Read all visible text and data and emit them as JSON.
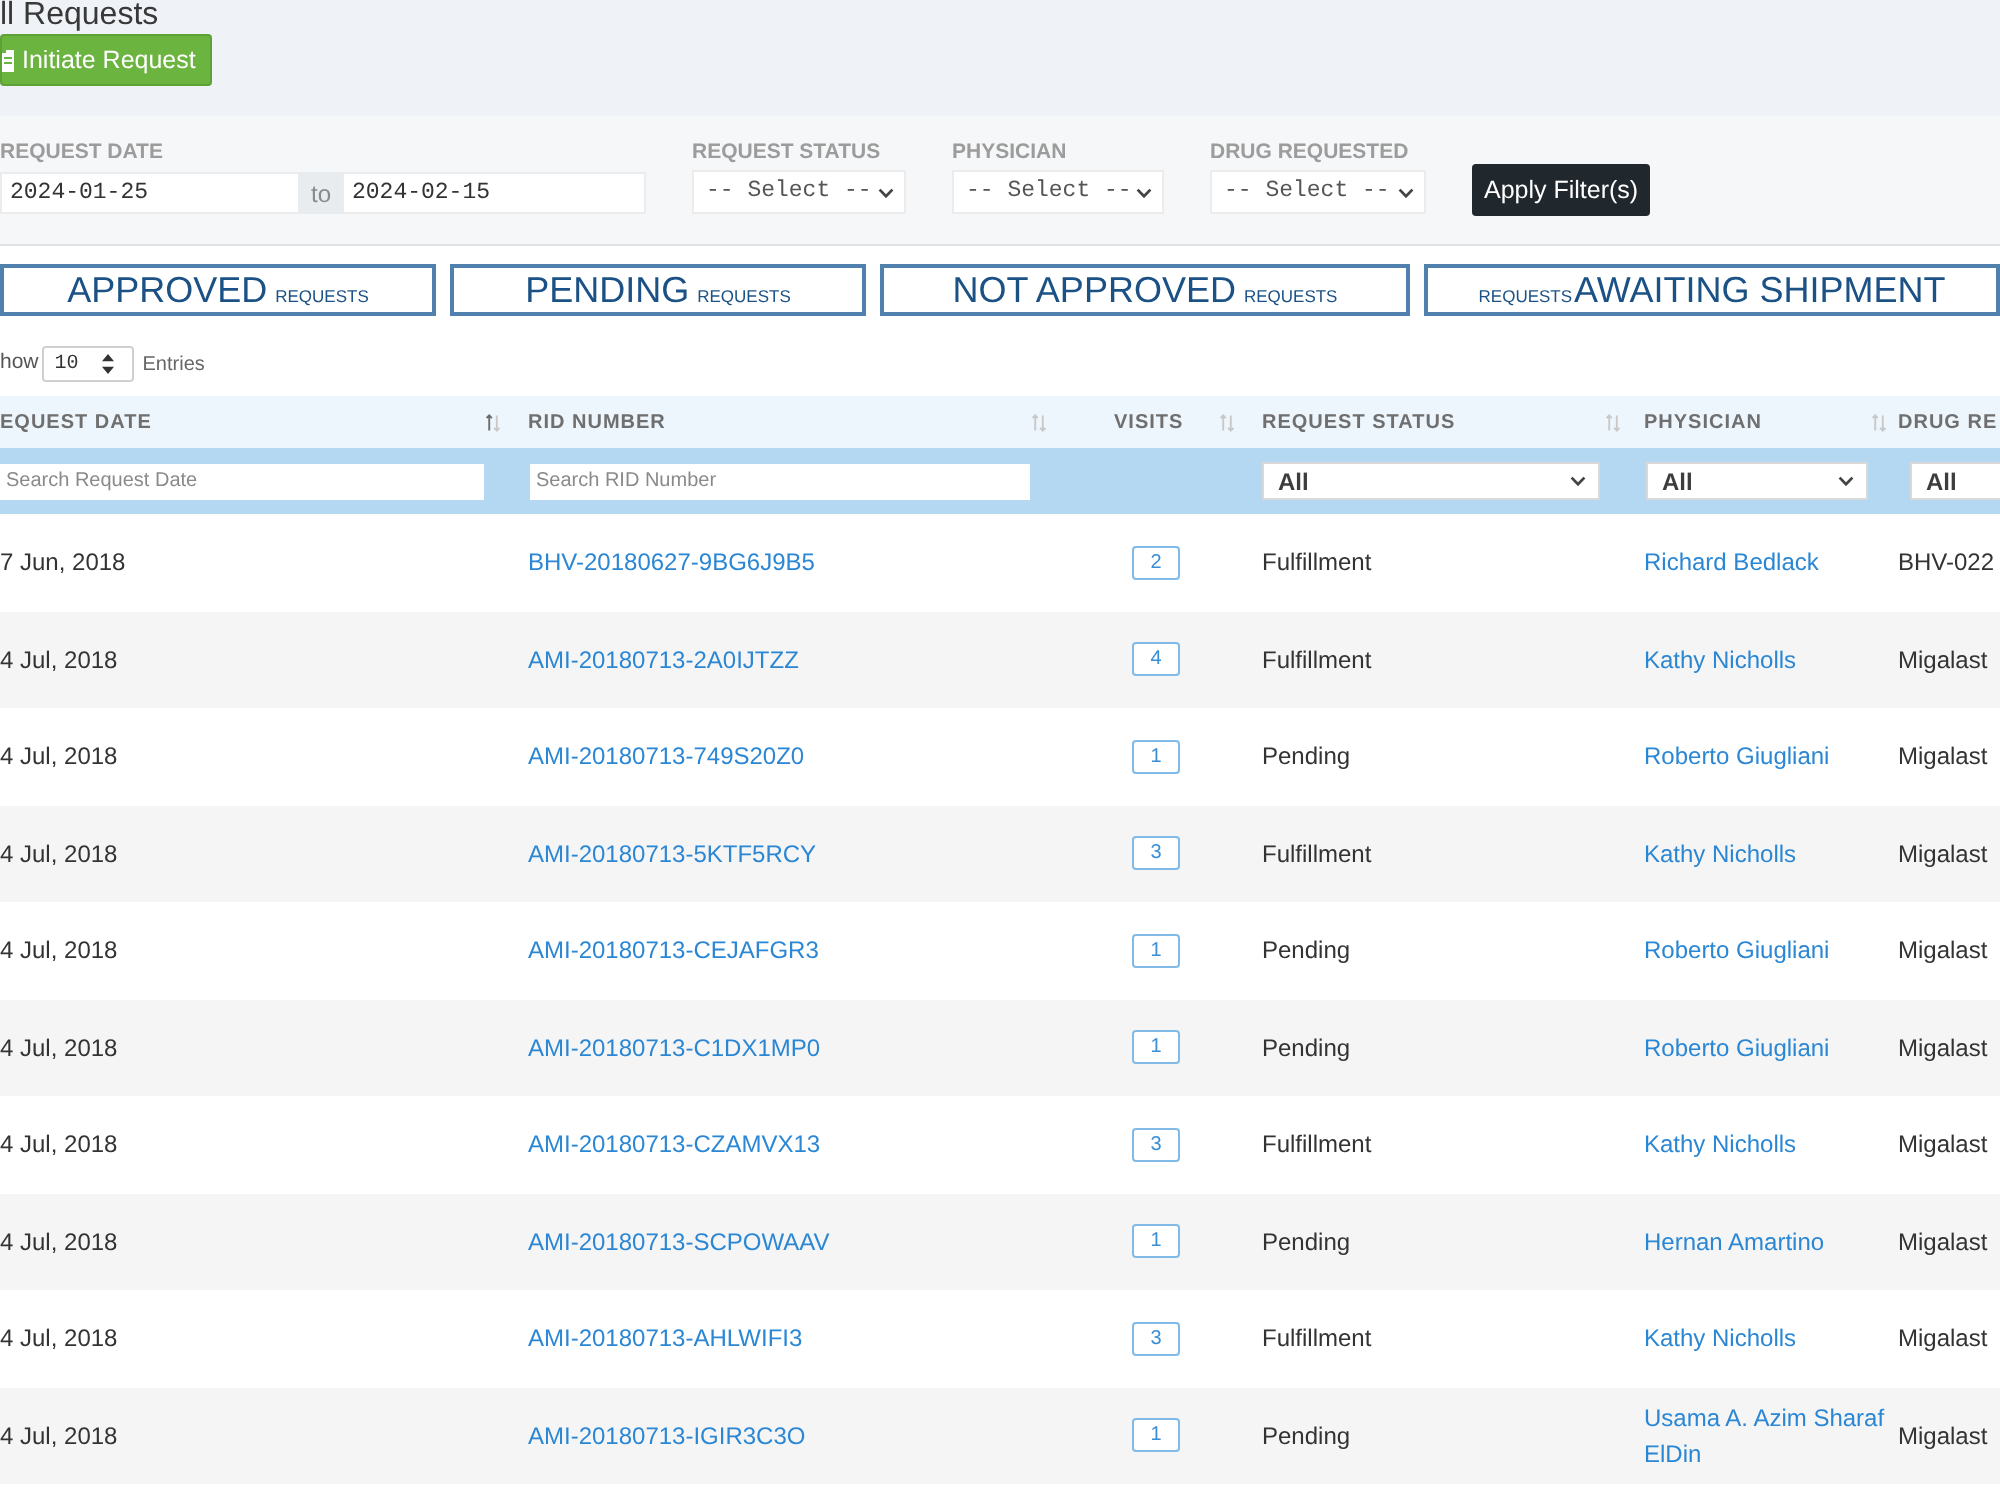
{
  "page": {
    "title": "ll Requests",
    "action_button": "Initiate Request"
  },
  "filters": {
    "date": {
      "label": "REQUEST DATE",
      "from": "2024-01-25",
      "separator": "to",
      "to": "2024-02-15"
    },
    "selects": [
      {
        "label": "REQUEST STATUS",
        "value": "-- Select --"
      },
      {
        "label": "PHYSICIAN",
        "value": "-- Select --"
      },
      {
        "label": "DRUG REQUESTED",
        "value": "-- Select --"
      }
    ],
    "apply_button": "Apply Filter(s)"
  },
  "status_cards": [
    {
      "label": "APPROVED",
      "suffix": "REQUESTS",
      "suffix_first": false
    },
    {
      "label": "PENDING",
      "suffix": "REQUESTS",
      "suffix_first": false
    },
    {
      "label": "NOT APPROVED",
      "suffix": "REQUESTS",
      "suffix_first": false
    },
    {
      "label": "AWAITING SHIPMENT",
      "suffix": "REQUESTS",
      "suffix_first": true
    }
  ],
  "page_length": {
    "prefix": "how",
    "value": "10",
    "suffix": "Entries"
  },
  "table": {
    "columns": [
      {
        "label": "EQUEST DATE",
        "kind": "text",
        "sortable": true,
        "sorted": true,
        "filter": {
          "kind": "text",
          "placeholder": "Search Request Date"
        }
      },
      {
        "label": "RID NUMBER",
        "kind": "link",
        "sortable": true,
        "sorted": false,
        "filter": {
          "kind": "text",
          "placeholder": "Search RID Number"
        }
      },
      {
        "label": "VISITS",
        "kind": "count",
        "sortable": true,
        "sorted": false
      },
      {
        "label": "REQUEST STATUS",
        "kind": "text",
        "sortable": true,
        "sorted": false,
        "filter": {
          "kind": "select",
          "value": "All"
        }
      },
      {
        "label": "PHYSICIAN",
        "kind": "link",
        "sortable": true,
        "sorted": false,
        "filter": {
          "kind": "select",
          "value": "All"
        }
      },
      {
        "label": "DRUG RE",
        "kind": "text",
        "filter": {
          "kind": "select",
          "value": "All"
        }
      }
    ],
    "rows": [
      {
        "request_date": "7 Jun, 2018",
        "rid_number": "BHV-20180627-9BG6J9B5",
        "visits": "2",
        "request_status": "Fulfillment",
        "physician": "Richard Bedlack",
        "drug_requested": "BHV-022"
      },
      {
        "request_date": "4 Jul, 2018",
        "rid_number": "AMI-20180713-2A0IJTZZ",
        "visits": "4",
        "request_status": "Fulfillment",
        "physician": "Kathy Nicholls",
        "drug_requested": "Migalast"
      },
      {
        "request_date": "4 Jul, 2018",
        "rid_number": "AMI-20180713-749S20Z0",
        "visits": "1",
        "request_status": "Pending",
        "physician": "Roberto Giugliani",
        "drug_requested": "Migalast"
      },
      {
        "request_date": "4 Jul, 2018",
        "rid_number": "AMI-20180713-5KTF5RCY",
        "visits": "3",
        "request_status": "Fulfillment",
        "physician": "Kathy Nicholls",
        "drug_requested": "Migalast"
      },
      {
        "request_date": "4 Jul, 2018",
        "rid_number": "AMI-20180713-CEJAFGR3",
        "visits": "1",
        "request_status": "Pending",
        "physician": "Roberto Giugliani",
        "drug_requested": "Migalast"
      },
      {
        "request_date": "4 Jul, 2018",
        "rid_number": "AMI-20180713-C1DX1MP0",
        "visits": "1",
        "request_status": "Pending",
        "physician": "Roberto Giugliani",
        "drug_requested": "Migalast"
      },
      {
        "request_date": "4 Jul, 2018",
        "rid_number": "AMI-20180713-CZAMVX13",
        "visits": "3",
        "request_status": "Fulfillment",
        "physician": "Kathy Nicholls",
        "drug_requested": "Migalast"
      },
      {
        "request_date": "4 Jul, 2018",
        "rid_number": "AMI-20180713-SCPOWAAV",
        "visits": "1",
        "request_status": "Pending",
        "physician": "Hernan Amartino",
        "drug_requested": "Migalast"
      },
      {
        "request_date": "4 Jul, 2018",
        "rid_number": "AMI-20180713-AHLWIFI3",
        "visits": "3",
        "request_status": "Fulfillment",
        "physician": "Kathy Nicholls",
        "drug_requested": "Migalast"
      },
      {
        "request_date": "4 Jul, 2018",
        "rid_number": "AMI-20180713-IGIR3C3O",
        "visits": "1",
        "request_status": "Pending",
        "physician": "Usama A. Azim Sharaf ElDin",
        "drug_requested": "Migalast"
      }
    ]
  }
}
